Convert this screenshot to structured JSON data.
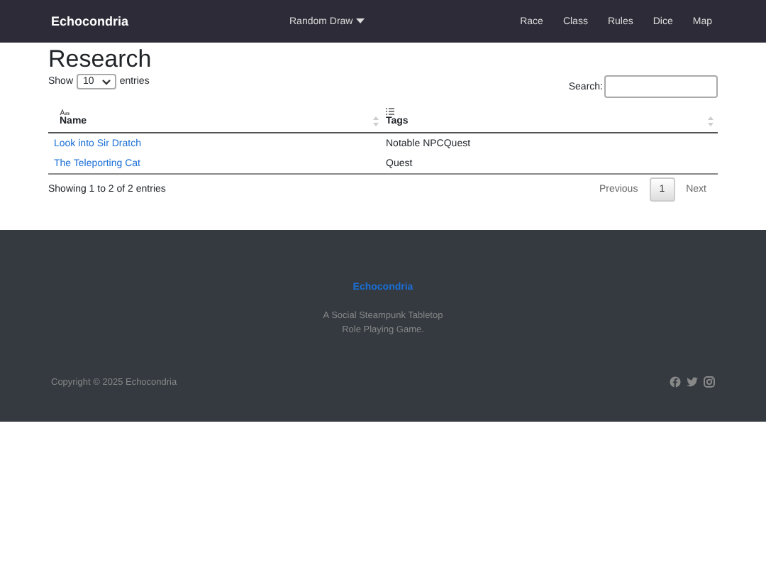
{
  "navbar": {
    "brand": "Echocondria",
    "dropdown": "Random Draw",
    "links": [
      "Race",
      "Class",
      "Rules",
      "Dice",
      "Map"
    ]
  },
  "page": {
    "title": "Research"
  },
  "table_controls": {
    "show_label": "Show",
    "page_size": "10",
    "entries_label": "entries",
    "search_label": "Search:"
  },
  "table": {
    "columns": [
      {
        "label": "Name",
        "kind": "text"
      },
      {
        "label": "Tags",
        "kind": "list"
      }
    ],
    "rows": [
      {
        "name": "Look into Sir Dratch",
        "tags": "Notable NPCQuest"
      },
      {
        "name": "The Teleporting Cat",
        "tags": "Quest"
      }
    ]
  },
  "table_info": "Showing 1 to 2 of 2 entries",
  "pagination": {
    "previous": "Previous",
    "pages": [
      {
        "label": "1",
        "selected": true
      }
    ],
    "next": "Next"
  },
  "footer": {
    "brand": "Echocondria",
    "tagline": [
      "A Social Steampunk Tabletop",
      "Role Playing Game."
    ],
    "copyright": "Copyright © 2025 Echocondria"
  }
}
